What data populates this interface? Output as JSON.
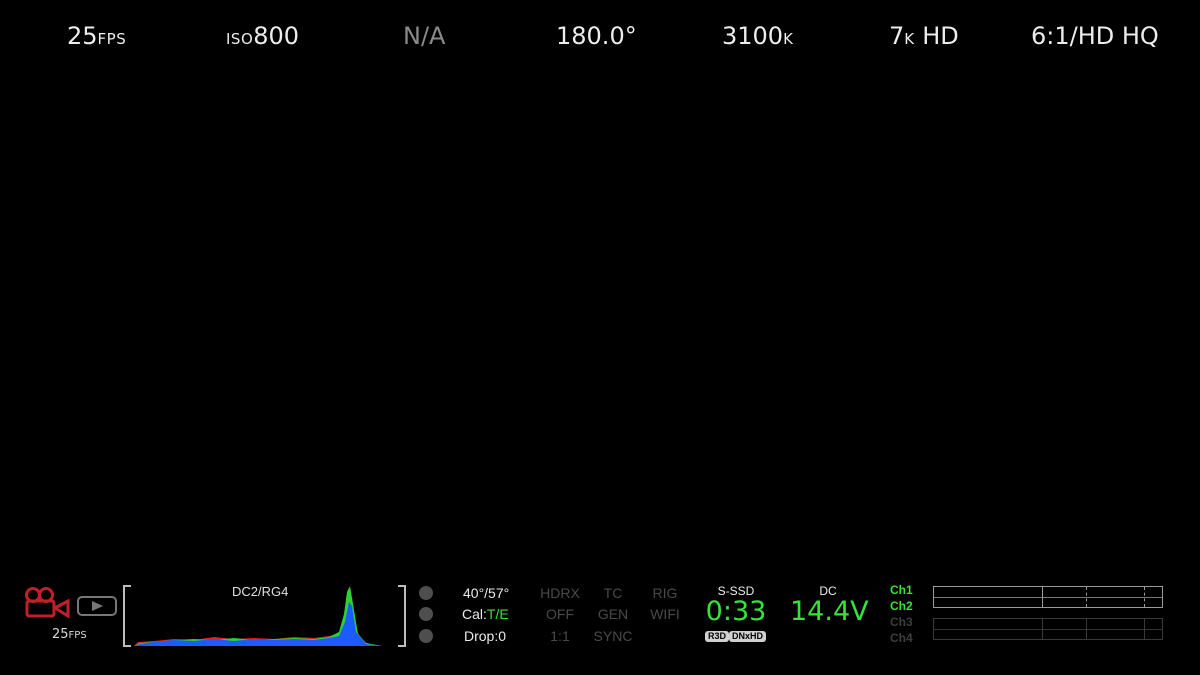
{
  "top_bar": {
    "fps": {
      "value": "25",
      "unit": "FPS"
    },
    "iso": {
      "prefix": "ISO",
      "value": "800"
    },
    "aperture": "N/A",
    "shutter": "180.0°",
    "white_balance": {
      "value": "3100",
      "unit": "K"
    },
    "resolution": {
      "value": "7",
      "unit": "K",
      "suffix": " HD"
    },
    "compression": "6:1/HD HQ"
  },
  "bottom_bar": {
    "fps_small": {
      "value": "25",
      "unit": "FPS"
    },
    "histogram_label": "DC2/RG4",
    "sensor_temp": "40°/57°",
    "cal": {
      "prefix": "Cal:",
      "value": "T/E"
    },
    "drop": "Drop:0",
    "hdrx": {
      "label": "HDRX",
      "value": "OFF",
      "ratio": "1:1"
    },
    "tc": {
      "label": "TC",
      "value": "GEN",
      "mode": "SYNC"
    },
    "rig": {
      "label": "RIG",
      "value": "WIFI"
    },
    "media": {
      "label": "S-SSD",
      "time": "0:33",
      "badges": [
        "R3D",
        "DNxHD"
      ]
    },
    "power": {
      "label": "DC",
      "voltage": "14.4V"
    },
    "audio_channels": [
      "Ch1",
      "Ch2",
      "Ch3",
      "Ch4"
    ],
    "audio_channel_active": [
      true,
      true,
      false,
      false
    ]
  },
  "colors": {
    "accent_green": "#37e337",
    "record_red": "#c0202a",
    "histogram_blue": "#1a5cff",
    "histogram_green": "#2fd02f",
    "histogram_red": "#e02020"
  },
  "icons": [
    "record-camera-icon",
    "play-icon"
  ]
}
